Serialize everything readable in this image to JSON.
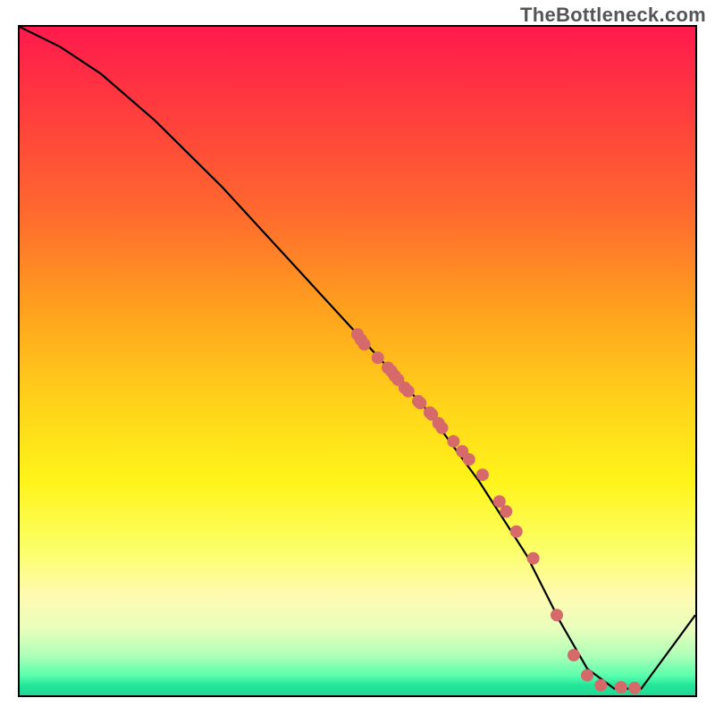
{
  "watermark": "TheBottleneck.com",
  "colors": {
    "point_fill": "#d66a6a",
    "curve_stroke": "#000000"
  },
  "chart_data": {
    "type": "line",
    "title": "",
    "xlabel": "",
    "ylabel": "",
    "xlim": [
      0,
      100
    ],
    "ylim": [
      0,
      100
    ],
    "curve": {
      "x": [
        0,
        6,
        12,
        20,
        30,
        40,
        50,
        60,
        68,
        75,
        80,
        84,
        88,
        92,
        100
      ],
      "y": [
        100,
        97,
        93,
        86,
        76,
        65,
        54,
        43,
        32,
        21,
        11,
        4,
        1,
        1,
        12
      ]
    },
    "series": [
      {
        "name": "markers",
        "x": [
          50,
          50.5,
          51,
          53,
          54.5,
          55,
          55.5,
          56,
          57,
          57.5,
          59,
          59.3,
          60.7,
          61,
          62,
          62.5,
          64.2,
          65.5,
          66.5,
          68.5,
          71,
          72,
          73.5,
          76,
          79.5,
          82,
          84,
          86,
          89,
          91
        ],
        "y": [
          54,
          53.2,
          52.5,
          50.5,
          49,
          48.5,
          47.8,
          47.2,
          46,
          45.5,
          44,
          43.7,
          42.3,
          42,
          40.7,
          40,
          38,
          36.5,
          35.3,
          33,
          29,
          27.5,
          24.5,
          20.5,
          12,
          6,
          3,
          1.5,
          1.2,
          1.1
        ]
      }
    ]
  }
}
